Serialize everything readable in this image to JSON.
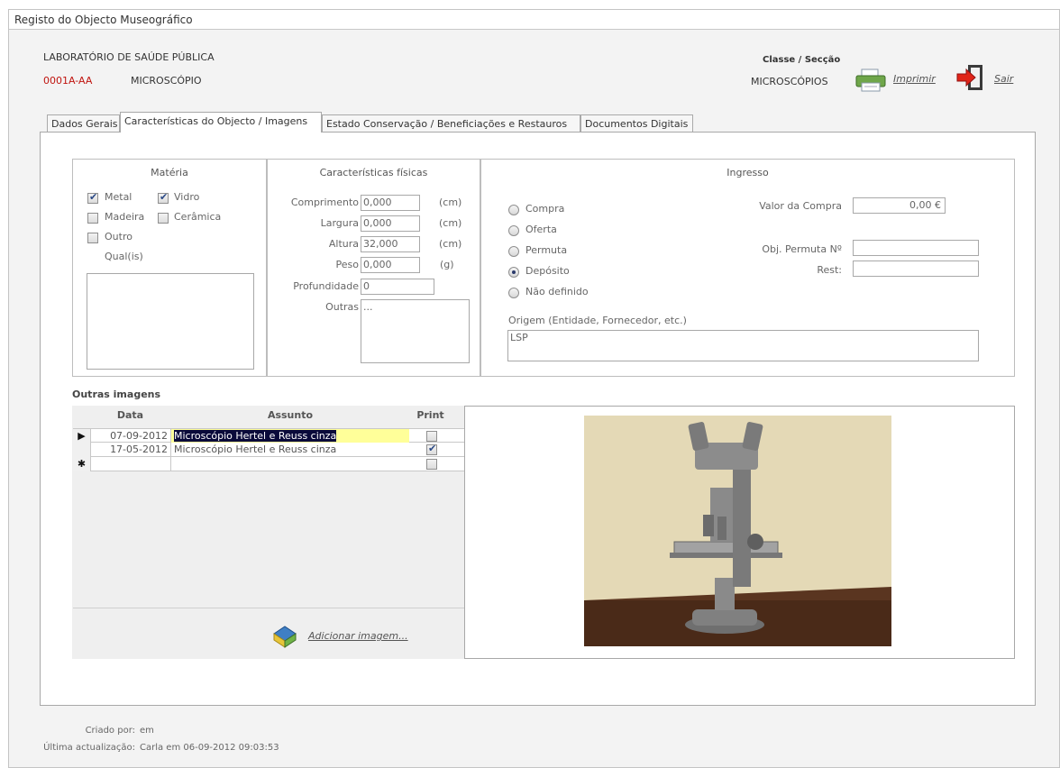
{
  "window": {
    "title": "Registo do Objecto Museográfico"
  },
  "header": {
    "org": "LABORATÓRIO DE SAÚDE PÚBLICA",
    "code": "0001A-AA",
    "name": "MICROSCÓPIO",
    "class_label": "Classe / Secção",
    "class_value": "MICROSCÓPIOS",
    "print_label": "Imprimir",
    "exit_label": "Sair"
  },
  "tabs": [
    {
      "label": "Dados Gerais",
      "active": false
    },
    {
      "label": "Características do Objecto / Imagens",
      "active": true
    },
    {
      "label": "Estado Conservação / Beneficiações e Restauros",
      "active": false
    },
    {
      "label": "Documentos Digitais",
      "active": false
    }
  ],
  "materia": {
    "title": "Matéria",
    "options": [
      {
        "label": "Metal",
        "checked": true
      },
      {
        "label": "Vidro",
        "checked": true
      },
      {
        "label": "Madeira",
        "checked": false
      },
      {
        "label": "Cerâmica",
        "checked": false
      },
      {
        "label": "Outro",
        "checked": false
      }
    ],
    "qual_label": "Qual(is)",
    "qual_value": ""
  },
  "caracteristicas": {
    "title": "Características físicas",
    "fields": [
      {
        "label": "Comprimento",
        "value": "0,000",
        "unit": "(cm)"
      },
      {
        "label": "Largura",
        "value": "0,000",
        "unit": "(cm)"
      },
      {
        "label": "Altura",
        "value": "32,000",
        "unit": "(cm)"
      },
      {
        "label": "Peso",
        "value": "0,000",
        "unit": "(g)"
      },
      {
        "label": "Profundidade",
        "value": "0",
        "unit": ""
      }
    ],
    "outras_label": "Outras",
    "outras_value": "..."
  },
  "ingresso": {
    "title": "Ingresso",
    "options": [
      {
        "label": "Compra",
        "selected": false
      },
      {
        "label": "Oferta",
        "selected": false
      },
      {
        "label": "Permuta",
        "selected": false
      },
      {
        "label": "Depósito",
        "selected": true
      },
      {
        "label": "Não definido",
        "selected": false
      }
    ],
    "valor_label": "Valor da Compra",
    "valor_value": "0,00 €",
    "permuta_label": "Obj. Permuta Nº",
    "permuta_value": "",
    "rest_label": "Rest:",
    "rest_value": "",
    "origem_label": "Origem (Entidade, Fornecedor, etc.)",
    "origem_value": "LSP"
  },
  "outras_imagens": {
    "title": "Outras imagens",
    "columns": [
      "Data",
      "Assunto",
      "Print"
    ],
    "rows": [
      {
        "marker": "▶",
        "data": "07-09-2012",
        "assunto": "Microscópio  Hertel e Reuss cinza",
        "print": false,
        "selected": true
      },
      {
        "marker": "",
        "data": "17-05-2012",
        "assunto": "Microscópio  Hertel e Reuss cinza",
        "print": true,
        "selected": false
      },
      {
        "marker": "✱",
        "data": "",
        "assunto": "",
        "print": false,
        "selected": false
      }
    ],
    "add_label": "Adicionar imagem..."
  },
  "footer": {
    "criado_label": "Criado por:",
    "criado_value": "em",
    "atualizacao_label": "Última actualização:",
    "atualizacao_value": "Carla em 06-09-2012 09:03:53"
  },
  "colors": {
    "accent_red": "#c0140f",
    "selection_bg": "#0a0a3a",
    "highlight_yellow": "#ffff99"
  }
}
